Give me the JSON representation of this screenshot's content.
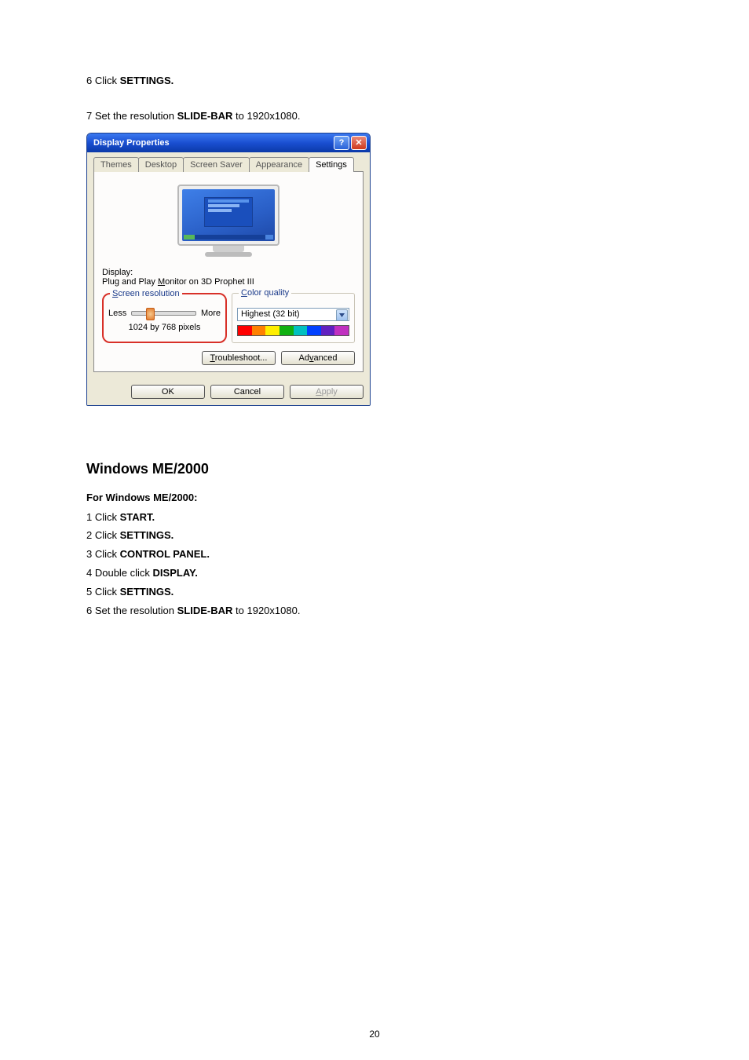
{
  "doc": {
    "step6_pre": "6 Click ",
    "step6_bold": "SETTINGS.",
    "step7_pre": "7 Set the resolution ",
    "step7_bold": "SLIDE-BAR",
    "step7_post": "  to 1920x1080.",
    "section_title": "Windows ME/2000",
    "subhead": "For Windows ME/2000:",
    "me_steps": [
      {
        "pre": "1 Click ",
        "bold": "START."
      },
      {
        "pre": "2 Click ",
        "bold": "SETTINGS."
      },
      {
        "pre": "3 Click ",
        "bold": "CONTROL PANEL."
      },
      {
        "pre": "4 Double click ",
        "bold": "DISPLAY."
      },
      {
        "pre": "5 Click ",
        "bold": "SETTINGS."
      },
      {
        "pre": "6 Set the resolution ",
        "bold": "SLIDE-BAR",
        "post": "  to 1920x1080."
      }
    ],
    "page_number": "20"
  },
  "dlg": {
    "title": "Display Properties",
    "help_glyph": "?",
    "close_glyph": "✕",
    "tabs": [
      "Themes",
      "Desktop",
      "Screen Saver",
      "Appearance",
      "Settings"
    ],
    "active_tab_index": 4,
    "display_label": "Display:",
    "display_value_pre": "Plug and Play ",
    "display_value_u": "M",
    "display_value_post": "onitor on 3D Prophet III",
    "screen_res": {
      "legend_u": "S",
      "legend_rest": "creen resolution",
      "less": "Less",
      "more": "More",
      "value": "1024 by 768 pixels"
    },
    "color_q": {
      "legend_u": "C",
      "legend_rest": "olor quality",
      "selected": "Highest (32 bit)"
    },
    "buttons": {
      "troubleshoot_u": "T",
      "troubleshoot_rest": "roubleshoot...",
      "advanced_pre": "Ad",
      "advanced_u": "v",
      "advanced_post": "anced",
      "ok": "OK",
      "cancel": "Cancel",
      "apply_u": "A",
      "apply_rest": "pply"
    }
  }
}
